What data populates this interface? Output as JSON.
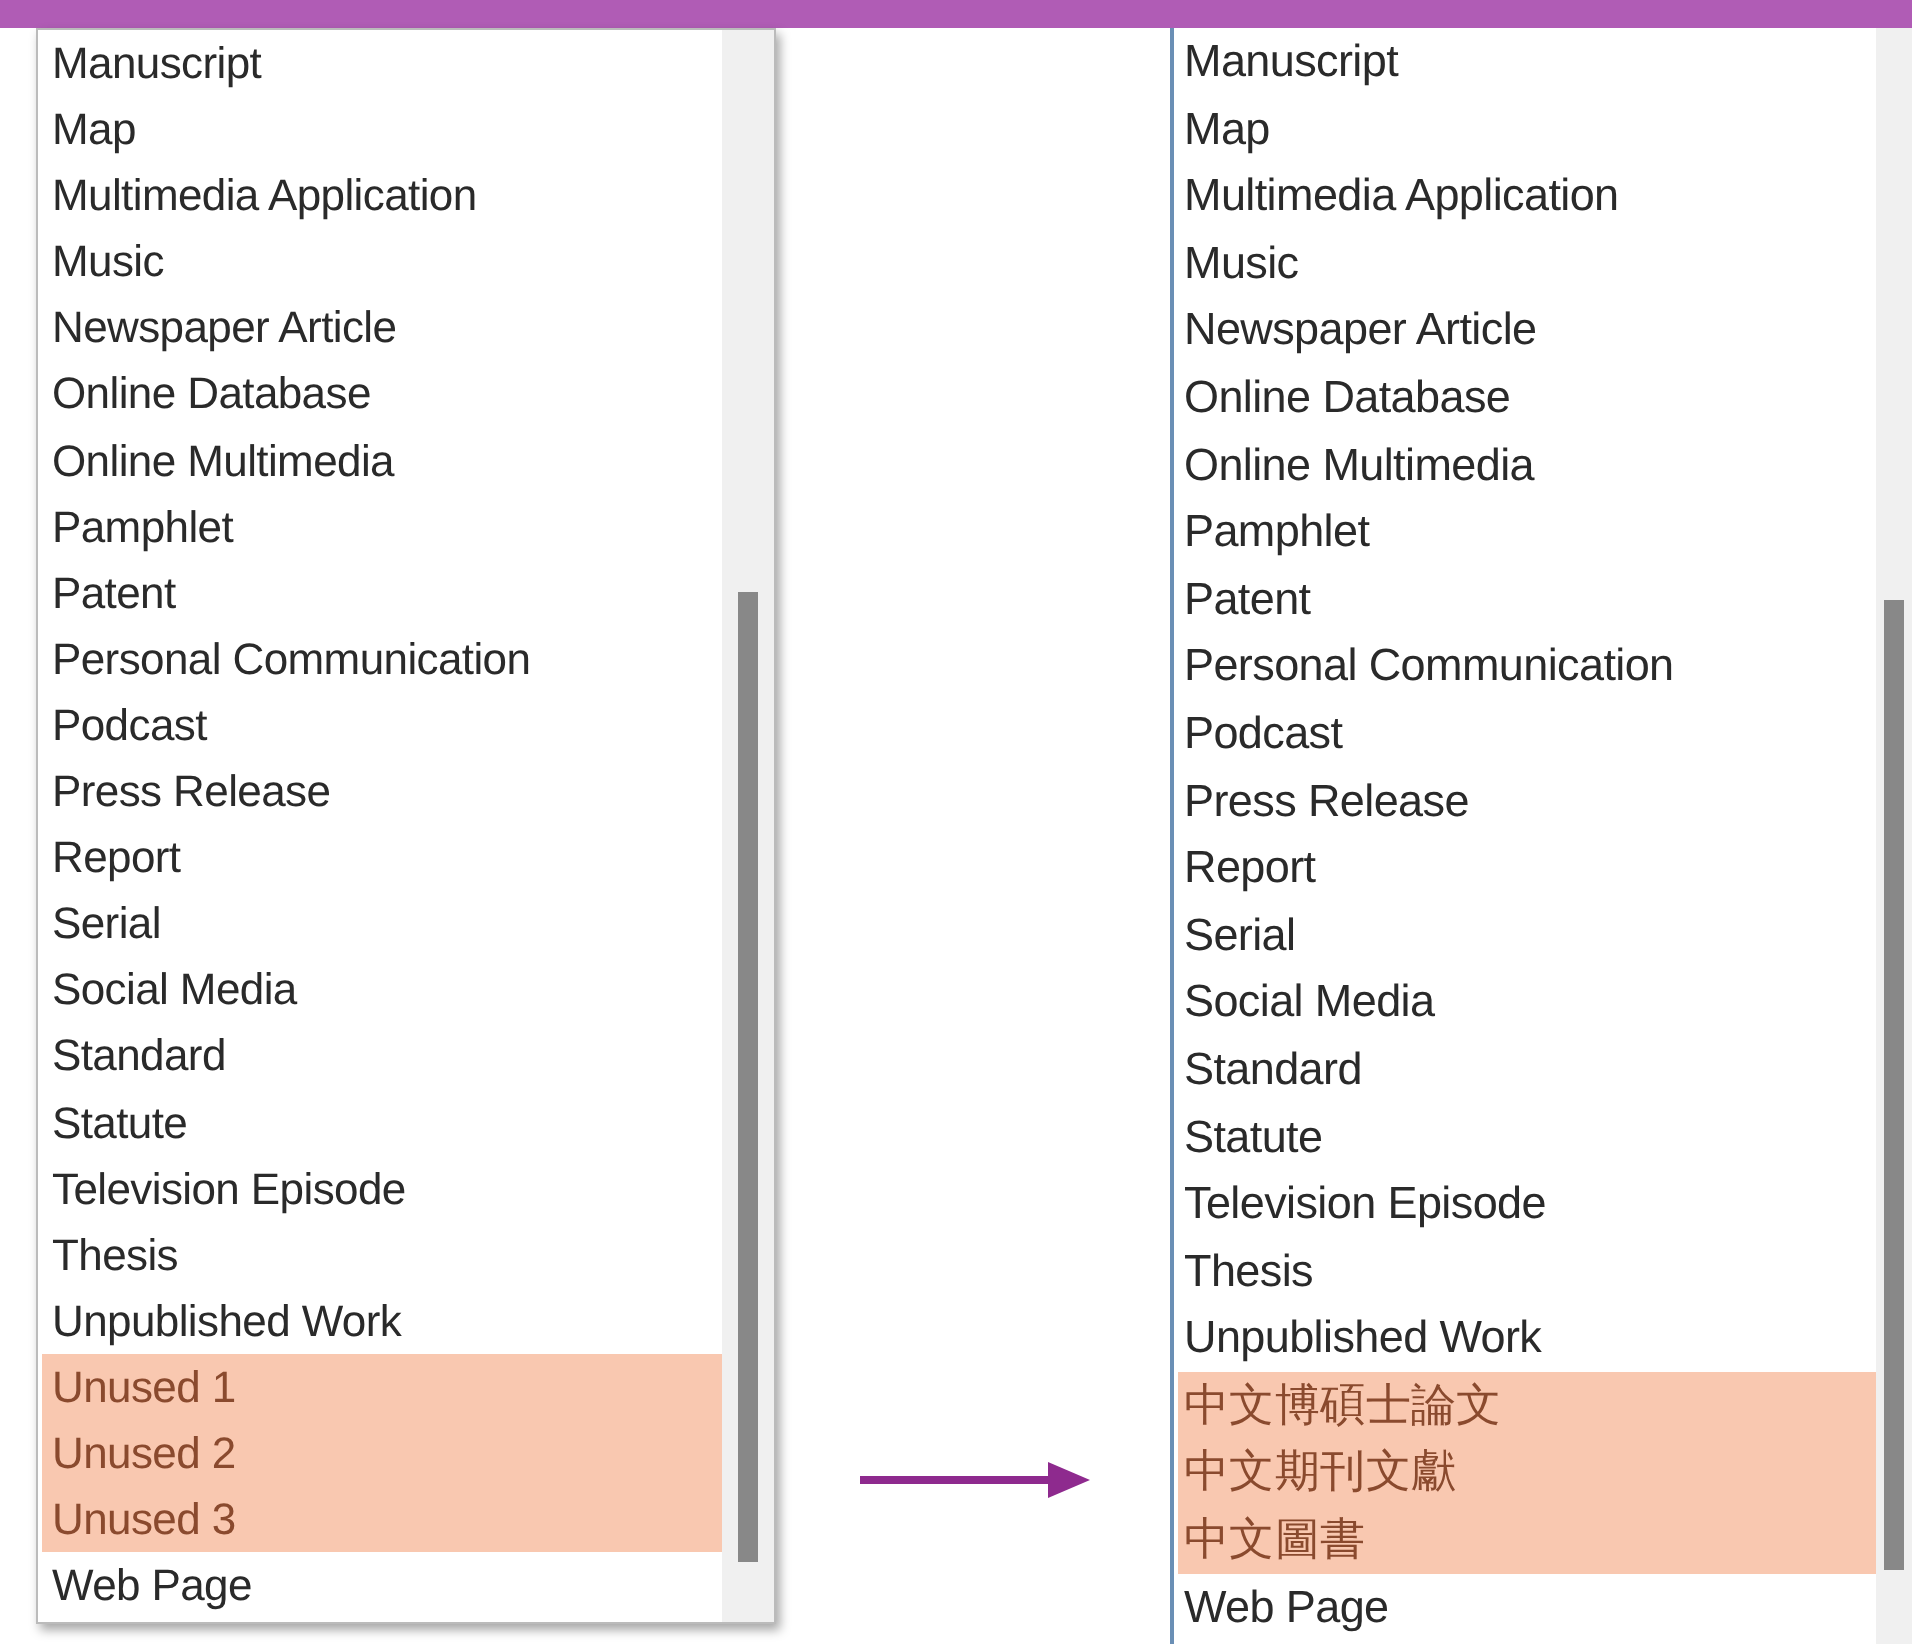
{
  "left_list": {
    "items": [
      {
        "label": "Manuscript",
        "selected": false
      },
      {
        "label": "Map",
        "selected": false
      },
      {
        "label": "Multimedia Application",
        "selected": false
      },
      {
        "label": "Music",
        "selected": false
      },
      {
        "label": "Newspaper Article",
        "selected": false
      },
      {
        "label": "Online Database",
        "selected": false
      },
      {
        "label": "Online Multimedia",
        "selected": false
      },
      {
        "label": "Pamphlet",
        "selected": false
      },
      {
        "label": "Patent",
        "selected": false
      },
      {
        "label": "Personal Communication",
        "selected": false
      },
      {
        "label": "Podcast",
        "selected": false
      },
      {
        "label": "Press Release",
        "selected": false
      },
      {
        "label": "Report",
        "selected": false
      },
      {
        "label": "Serial",
        "selected": false
      },
      {
        "label": "Social Media",
        "selected": false
      },
      {
        "label": "Standard",
        "selected": false
      },
      {
        "label": "Statute",
        "selected": false
      },
      {
        "label": "Television Episode",
        "selected": false
      },
      {
        "label": "Thesis",
        "selected": false
      },
      {
        "label": "Unpublished Work",
        "selected": false
      },
      {
        "label": "Unused 1",
        "selected": true
      },
      {
        "label": "Unused 2",
        "selected": true
      },
      {
        "label": "Unused 3",
        "selected": true
      },
      {
        "label": "Web Page",
        "selected": false
      }
    ]
  },
  "right_list": {
    "items": [
      {
        "label": "Manuscript",
        "selected": false
      },
      {
        "label": "Map",
        "selected": false
      },
      {
        "label": "Multimedia Application",
        "selected": false
      },
      {
        "label": "Music",
        "selected": false
      },
      {
        "label": "Newspaper Article",
        "selected": false
      },
      {
        "label": "Online Database",
        "selected": false
      },
      {
        "label": "Online Multimedia",
        "selected": false
      },
      {
        "label": "Pamphlet",
        "selected": false
      },
      {
        "label": "Patent",
        "selected": false
      },
      {
        "label": "Personal Communication",
        "selected": false
      },
      {
        "label": "Podcast",
        "selected": false
      },
      {
        "label": "Press Release",
        "selected": false
      },
      {
        "label": "Report",
        "selected": false
      },
      {
        "label": "Serial",
        "selected": false
      },
      {
        "label": "Social Media",
        "selected": false
      },
      {
        "label": "Standard",
        "selected": false
      },
      {
        "label": "Statute",
        "selected": false
      },
      {
        "label": "Television Episode",
        "selected": false
      },
      {
        "label": "Thesis",
        "selected": false
      },
      {
        "label": "Unpublished Work",
        "selected": false
      },
      {
        "label": "中文博碩士論文",
        "selected": true
      },
      {
        "label": "中文期刊文獻",
        "selected": true
      },
      {
        "label": "中文圖書",
        "selected": true
      },
      {
        "label": "Web Page",
        "selected": false
      }
    ]
  }
}
